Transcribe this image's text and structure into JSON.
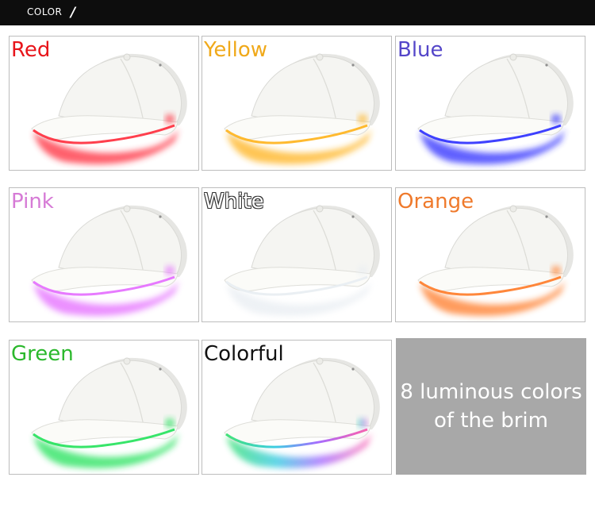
{
  "header": {
    "title": "COLOR",
    "slash": "/"
  },
  "panels": [
    {
      "label": "Red",
      "color": "#e8151b",
      "glow": "#ff2a3a",
      "outline": false
    },
    {
      "label": "Yellow",
      "color": "#f0a91a",
      "glow": "#ffb21a",
      "outline": false
    },
    {
      "label": "Blue",
      "color": "#5446c9",
      "glow": "#2a2cff",
      "outline": false
    },
    {
      "label": "Pink",
      "color": "#d67bd6",
      "glow": "#e46bff",
      "outline": false
    },
    {
      "label": "White",
      "color": "#ffffff",
      "glow": "#e8edf2",
      "outline": true
    },
    {
      "label": "Orange",
      "color": "#ef7a2c",
      "glow": "#ff7a26",
      "outline": false
    },
    {
      "label": "Green",
      "color": "#2bb82c",
      "glow": "#22e25a",
      "outline": false
    },
    {
      "label": "Colorful",
      "color": "#111111",
      "glow": "#37d6c8",
      "outline": false
    }
  ],
  "info": {
    "line1": "8 luminous colors",
    "line2": "of the brim"
  }
}
